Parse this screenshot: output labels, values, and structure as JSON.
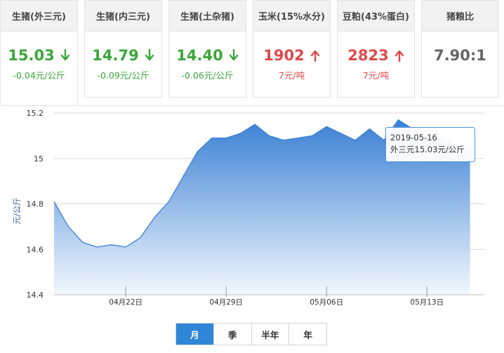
{
  "cards": [
    {
      "id": "hog-external",
      "title": "生猪(外三元)",
      "price": "15.03",
      "change": "-0.04元/公斤",
      "trend": "down"
    },
    {
      "id": "hog-internal",
      "title": "生猪(内三元)",
      "price": "14.79",
      "change": "-0.09元/公斤",
      "trend": "down"
    },
    {
      "id": "hog-local",
      "title": "生猪(土杂猪)",
      "price": "14.40",
      "change": "-0.06元/公斤",
      "trend": "down"
    },
    {
      "id": "corn",
      "title": "玉米(15%水分)",
      "price": "1902",
      "change": "7元/吨",
      "trend": "up"
    },
    {
      "id": "soymeal",
      "title": "豆粕(43%蛋白)",
      "price": "2823",
      "change": "7元/吨",
      "trend": "up"
    },
    {
      "id": "hog-grain-ratio",
      "title": "猪粮比",
      "price": "7.90:1",
      "change": "",
      "trend": "none"
    }
  ],
  "colors": {
    "down": "#3aa63a",
    "up": "#e0484b",
    "line": "#3a80d4",
    "area_top": "#3a80d4",
    "area_bottom": "#f3f8fe",
    "selected_tab": "#2f86d6"
  },
  "tooltip": {
    "date": "2019-05-16",
    "label": "外三元15.03元/公斤"
  },
  "tabs": [
    {
      "id": "month",
      "label": "月",
      "selected": true
    },
    {
      "id": "quarter",
      "label": "季",
      "selected": false
    },
    {
      "id": "half-year",
      "label": "半年",
      "selected": false
    },
    {
      "id": "year",
      "label": "年",
      "selected": false
    }
  ],
  "chart_data": {
    "type": "area",
    "ylabel": "元/公斤",
    "xlabel": "",
    "title": "",
    "ylim": [
      14.4,
      15.2
    ],
    "yticks": [
      14.4,
      14.6,
      14.8,
      15,
      15.2
    ],
    "ytick_labels": [
      "14.4",
      "14.6",
      "14.8",
      "15",
      "15.2"
    ],
    "xticks": [
      {
        "date": "2019-04-22",
        "label": "04月22日"
      },
      {
        "date": "2019-04-29",
        "label": "04月29日"
      },
      {
        "date": "2019-05-06",
        "label": "05月06日"
      },
      {
        "date": "2019-05-13",
        "label": "05月13日"
      }
    ],
    "xlim": [
      "2019-04-17",
      "2019-05-17"
    ],
    "grid": true,
    "series": [
      {
        "x": [
          "2019-04-17",
          "2019-04-18",
          "2019-04-19",
          "2019-04-20",
          "2019-04-21",
          "2019-04-22",
          "2019-04-23",
          "2019-04-24",
          "2019-04-25",
          "2019-04-26",
          "2019-04-27",
          "2019-04-28",
          "2019-04-29",
          "2019-04-30",
          "2019-05-01",
          "2019-05-02",
          "2019-05-03",
          "2019-05-04",
          "2019-05-05",
          "2019-05-06",
          "2019-05-07",
          "2019-05-08",
          "2019-05-09",
          "2019-05-10",
          "2019-05-11",
          "2019-05-12",
          "2019-05-13",
          "2019-05-14",
          "2019-05-15",
          "2019-05-16"
        ],
        "values": [
          14.81,
          14.7,
          14.63,
          14.61,
          14.62,
          14.61,
          14.65,
          14.74,
          14.81,
          14.92,
          15.03,
          15.09,
          15.09,
          15.11,
          15.15,
          15.1,
          15.08,
          15.09,
          15.1,
          15.14,
          15.11,
          15.08,
          15.13,
          15.08,
          15.17,
          15.13,
          15.09,
          15.09,
          15.06,
          15.03
        ]
      }
    ]
  }
}
